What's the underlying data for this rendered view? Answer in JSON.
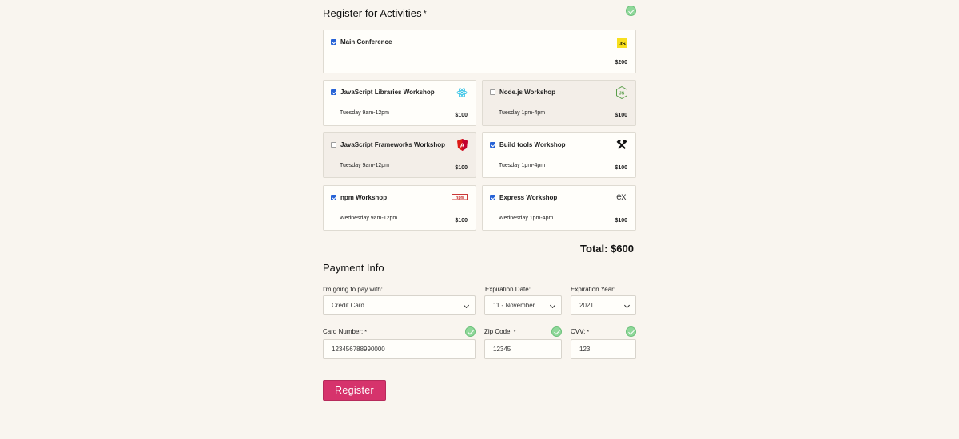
{
  "activities": {
    "title": "Register for Activities",
    "required_mark": "*",
    "items": [
      {
        "name": "Main Conference",
        "when": "",
        "price": "$200",
        "checked": true,
        "disabled": false,
        "icon": "javascript-icon"
      },
      {
        "name": "JavaScript Libraries Workshop",
        "when": "Tuesday 9am-12pm",
        "price": "$100",
        "checked": true,
        "disabled": false,
        "icon": "react-icon"
      },
      {
        "name": "Node.js Workshop",
        "when": "Tuesday 1pm-4pm",
        "price": "$100",
        "checked": false,
        "disabled": true,
        "icon": "nodejs-icon"
      },
      {
        "name": "JavaScript Frameworks Workshop",
        "when": "Tuesday 9am-12pm",
        "price": "$100",
        "checked": false,
        "disabled": true,
        "icon": "angular-icon"
      },
      {
        "name": "Build tools Workshop",
        "when": "Tuesday 1pm-4pm",
        "price": "$100",
        "checked": true,
        "disabled": false,
        "icon": "build-tools-icon"
      },
      {
        "name": "npm Workshop",
        "when": "Wednesday 9am-12pm",
        "price": "$100",
        "checked": true,
        "disabled": false,
        "icon": "npm-icon"
      },
      {
        "name": "Express Workshop",
        "when": "Wednesday 1pm-4pm",
        "price": "$100",
        "checked": true,
        "disabled": false,
        "icon": "express-icon"
      }
    ],
    "total": "Total: $600"
  },
  "payment": {
    "title": "Payment Info",
    "pay_with_label": "I'm going to pay with:",
    "pay_with_value": "Credit Card",
    "exp_date_label": "Expiration Date:",
    "exp_date_value": "11 - November",
    "exp_year_label": "Expiration Year:",
    "exp_year_value": "2021",
    "card_label": "Card Number:",
    "card_value": "123456788990000",
    "zip_label": "Zip Code:",
    "zip_value": "12345",
    "cvv_label": "CVV:",
    "cvv_value": "123",
    "required_mark": "*"
  },
  "register_button": "Register",
  "colors": {
    "background": "#f9f5ef",
    "checkbox_checked": "#2763d6",
    "valid_check": "#8fd89a",
    "register_button": "#d6336c"
  }
}
